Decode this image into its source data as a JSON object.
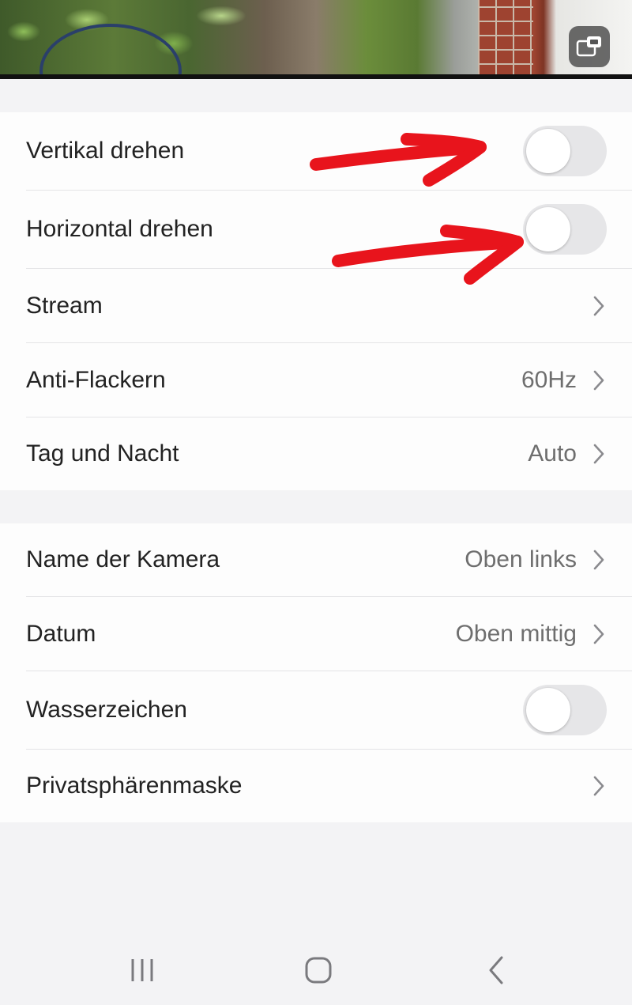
{
  "preview": {
    "pip_icon": "picture-in-picture-icon"
  },
  "group1": [
    {
      "id": "vertical-flip",
      "label": "Vertikal drehen",
      "type": "toggle",
      "on": false
    },
    {
      "id": "horizontal-flip",
      "label": "Horizontal drehen",
      "type": "toggle",
      "on": false
    },
    {
      "id": "stream",
      "label": "Stream",
      "type": "link",
      "value": ""
    },
    {
      "id": "anti-flicker",
      "label": "Anti-Flackern",
      "type": "link",
      "value": "60Hz"
    },
    {
      "id": "day-night",
      "label": "Tag und Nacht",
      "type": "link",
      "value": "Auto"
    }
  ],
  "group2": [
    {
      "id": "camera-name",
      "label": "Name der Kamera",
      "type": "link",
      "value": "Oben links"
    },
    {
      "id": "date",
      "label": "Datum",
      "type": "link",
      "value": "Oben mittig"
    },
    {
      "id": "watermark",
      "label": "Wasserzeichen",
      "type": "toggle",
      "on": false
    },
    {
      "id": "privacy-mask",
      "label": "Privatsphärenmaske",
      "type": "link",
      "value": ""
    }
  ],
  "colors": {
    "background": "#f3f3f5",
    "card": "#fdfdfd",
    "toggle_off": "#e6e6e8",
    "annotation_arrow": "#e8141c",
    "secondary_text": "#6e6e6e"
  },
  "navbar": {
    "recent_icon": "recent-apps-icon",
    "home_icon": "home-icon",
    "back_icon": "back-icon"
  }
}
